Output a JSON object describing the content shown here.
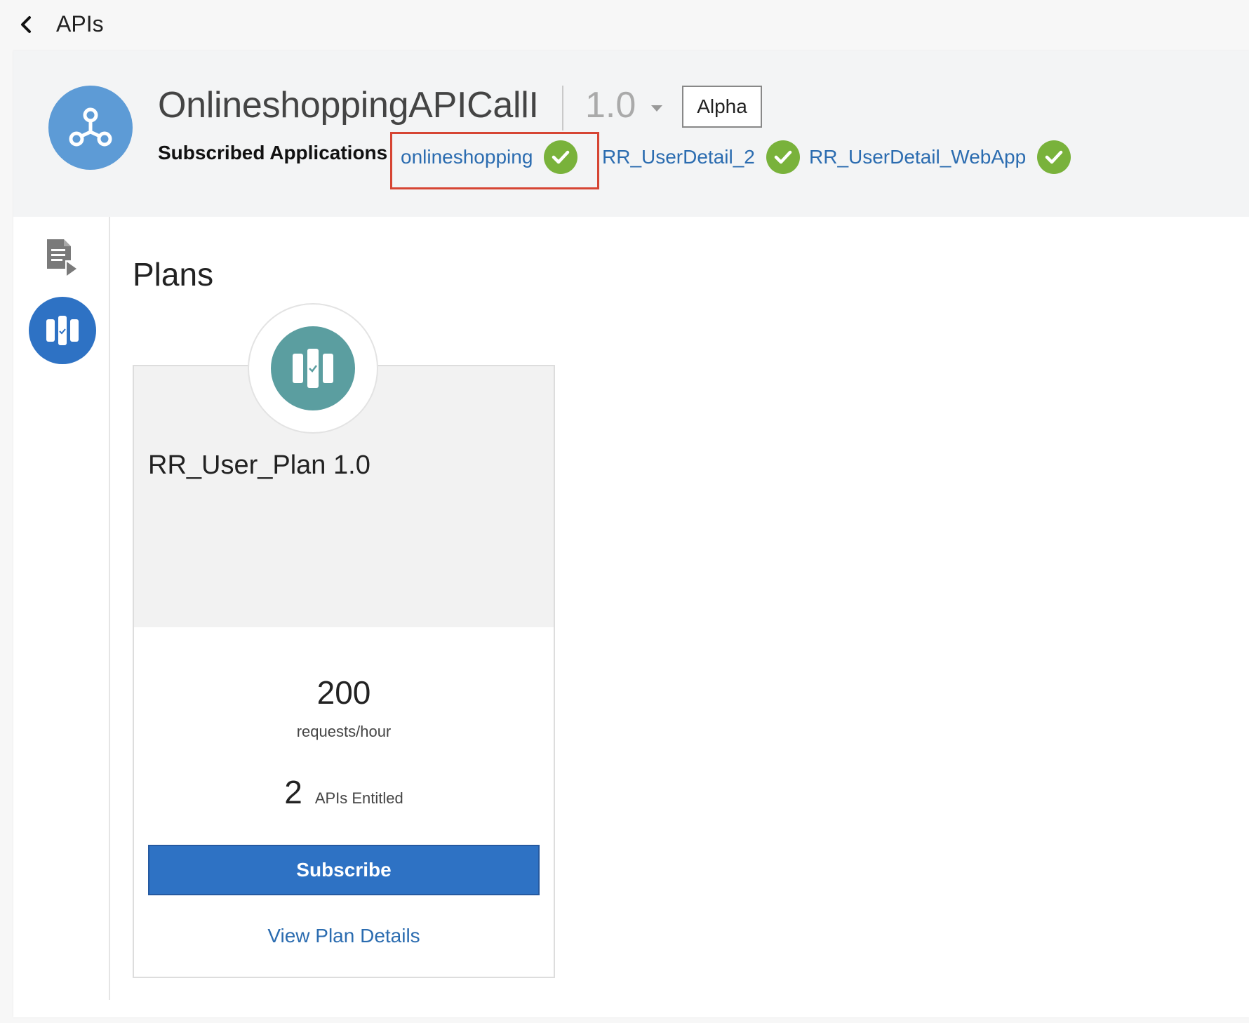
{
  "nav": {
    "back_title": "APIs"
  },
  "api": {
    "title": "OnlineshoppingAPICallI",
    "version": "1.0",
    "badge": "Alpha",
    "subscribed_label": "Subscribed Applications",
    "applications": [
      {
        "name": "onlineshopping",
        "status": "subscribed",
        "highlighted": true
      },
      {
        "name": "RR_UserDetail_2",
        "status": "subscribed"
      },
      {
        "name": "RR_UserDetail_WebApp",
        "status": "subscribed"
      }
    ]
  },
  "sidebar": {
    "items": [
      {
        "name": "documentation",
        "icon": "document-arrow-icon",
        "active": false
      },
      {
        "name": "plans",
        "icon": "plans-icon",
        "active": true
      }
    ]
  },
  "plans": {
    "heading": "Plans",
    "cards": [
      {
        "name": "RR_User_Plan 1.0",
        "rate_value": "200",
        "rate_unit": "requests/hour",
        "apis_count": "2",
        "apis_label": "APIs Entitled",
        "subscribe_label": "Subscribe",
        "details_label": "View Plan Details"
      }
    ]
  },
  "colors": {
    "accent": "#2e72c4",
    "link": "#2b6cb0",
    "success": "#79b23b",
    "highlight": "#d64533",
    "api_logo": "#5d9bd6",
    "plan_icon": "#5b9ea0"
  }
}
